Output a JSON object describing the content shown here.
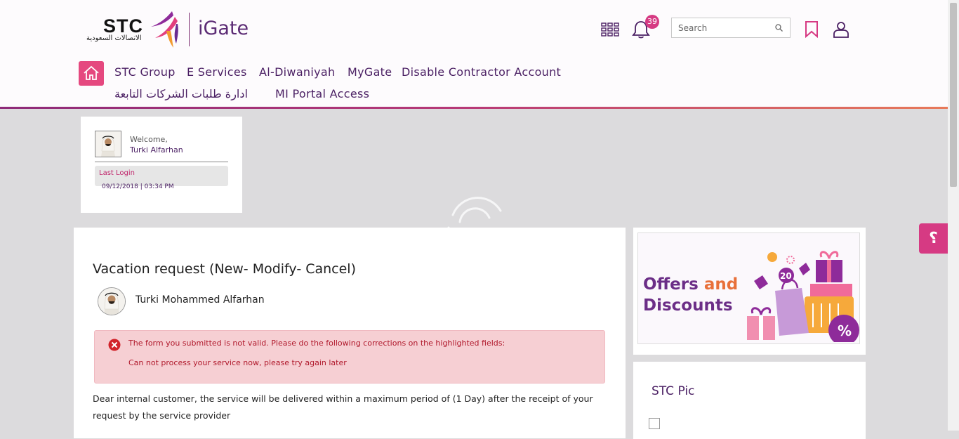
{
  "header": {
    "logo_text": "STC",
    "logo_arabic": "الاتصالات السعودية",
    "app_name": "iGate",
    "notification_count": "39",
    "search_placeholder": "Search"
  },
  "nav": {
    "items": [
      {
        "label": "STC Group"
      },
      {
        "label": "E Services"
      },
      {
        "label": "Al-Diwaniyah"
      },
      {
        "label": "MyGate"
      },
      {
        "label": "Disable Contractor Account"
      },
      {
        "label": "ادارة طلبات الشركات التابعة"
      },
      {
        "label": "MI Portal Access"
      }
    ]
  },
  "welcome": {
    "greeting": "Welcome,",
    "name": "Turki Alfarhan",
    "last_login_label": "Last Login",
    "last_login_time": "09/12/2018 | 03:34 PM"
  },
  "main": {
    "title": "Vacation request (New- Modify- Cancel)",
    "employee_name": "Turki Mohammed Alfarhan",
    "error_message": "The form you submitted is not valid. Please do the following corrections on the highlighted fields:",
    "error_detail": "Can not process your service now, please try again later",
    "notice": "Dear internal customer, the service will be delivered within a maximum period of (1 Day) after the receipt of your request by the service provider"
  },
  "offers": {
    "line1": "Offers",
    "and": "and",
    "line2": "Discounts"
  },
  "stc_pic": {
    "title": "STC Pic"
  },
  "help": {
    "label": "؟"
  },
  "colors": {
    "brand_purple": "#4a1f63",
    "accent_pink": "#e5487f",
    "badge": "#d63a83",
    "error_bg": "#f6cfd3"
  }
}
